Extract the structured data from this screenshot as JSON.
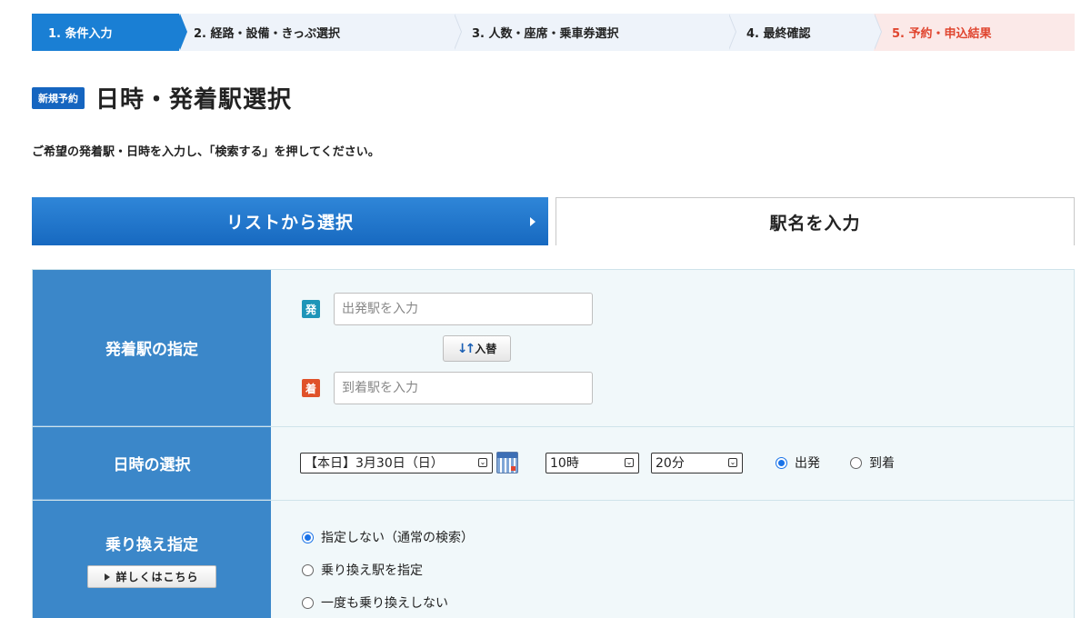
{
  "steps": [
    {
      "label": "1. 条件入力",
      "state": "active"
    },
    {
      "label": "2. 経路・設備・きっぷ選択",
      "state": "pending"
    },
    {
      "label": "3. 人数・座席・乗車券選択",
      "state": "pending"
    },
    {
      "label": "4. 最終確認",
      "state": "pending"
    },
    {
      "label": "5. 予約・申込結果",
      "state": "final"
    }
  ],
  "header": {
    "badge": "新規予約",
    "title": "日時・発着駅選択",
    "instruction": "ご希望の発着駅・日時を入力し、「検索する」を押してください。"
  },
  "tabs": {
    "list_label": "リストから選択",
    "name_label": "駅名を入力"
  },
  "stations": {
    "label": "発着駅の指定",
    "departure_tag": "発",
    "departure_placeholder": "出発駅を入力",
    "arrival_tag": "着",
    "arrival_placeholder": "到着駅を入力",
    "swap_icon": "↓↑",
    "swap_label": "入替"
  },
  "datetime": {
    "label": "日時の選択",
    "date_value": "【本日】3月30日（日）",
    "hour_value": "10時",
    "minute_value": "20分",
    "departure_label": "出発",
    "arrival_label": "到着",
    "selected": "departure"
  },
  "transfer": {
    "label": "乗り換え指定",
    "details_label": "詳しくはこちら",
    "options": [
      {
        "label": "指定しない（通常の検索）",
        "selected": true
      },
      {
        "label": "乗り換え駅を指定",
        "selected": false
      },
      {
        "label": "一度も乗り換えしない",
        "selected": false
      }
    ]
  },
  "colors": {
    "accent": "#1a7fd4",
    "label_bg": "#3b87c9",
    "departure_tag": "#1e95b8",
    "arrival_tag": "#e0522a",
    "final_step": "#e0452f"
  }
}
